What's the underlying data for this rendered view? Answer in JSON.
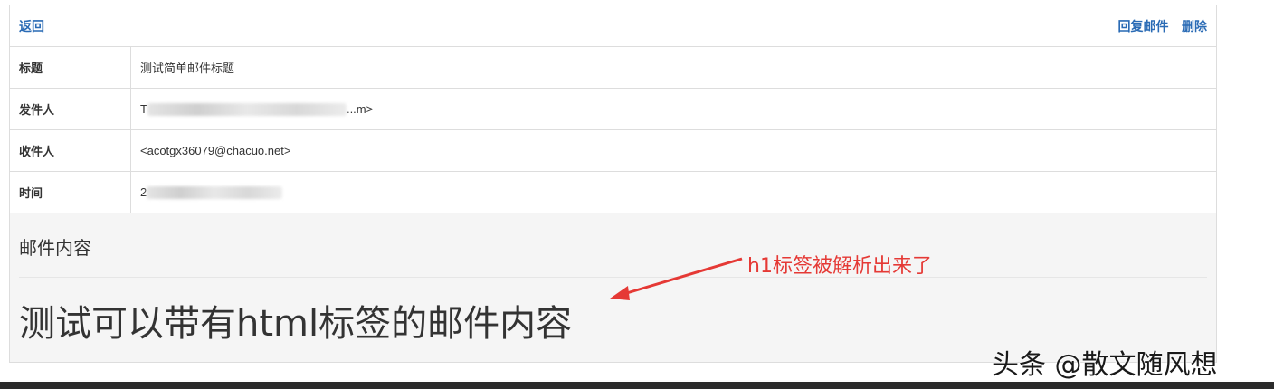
{
  "header": {
    "back_label": "返回",
    "reply_label": "回复邮件",
    "delete_label": "删除"
  },
  "meta": {
    "subject_key": "标题",
    "subject_value": "测试简单邮件标题",
    "from_key": "发件人",
    "from_value_visible": "T",
    "from_value_tail": "...m>",
    "to_key": "收件人",
    "to_value": "<acotgx36079@chacuo.net>",
    "time_key": "时间",
    "time_value_visible": "2"
  },
  "content": {
    "label": "邮件内容",
    "h1_text": "测试可以带有html标签的邮件内容"
  },
  "annotation": {
    "text": "h1标签被解析出来了",
    "color": "#e53935"
  },
  "watermark": "头条 @散文随风想"
}
